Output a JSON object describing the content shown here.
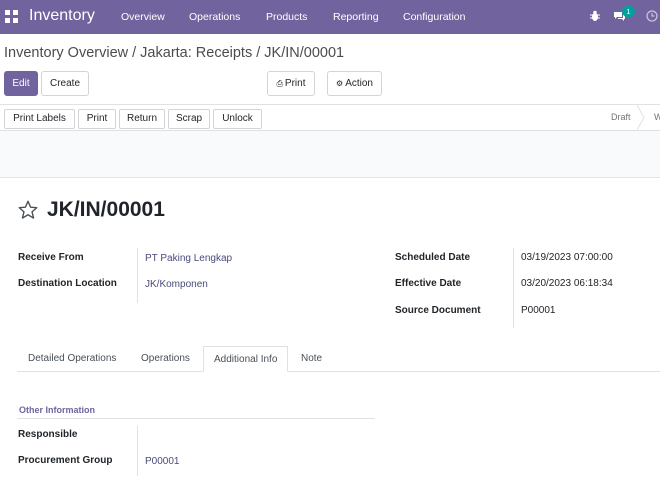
{
  "navbar": {
    "app_name": "Inventory",
    "menu": [
      "Overview",
      "Operations",
      "Products",
      "Reporting",
      "Configuration"
    ],
    "chat_badge": "1",
    "icons": [
      "apps-icon",
      "bug-icon",
      "chat-icon",
      "clock-icon"
    ],
    "color": "#71639e"
  },
  "breadcrumb": "Inventory Overview / Jakarta: Receipts / JK/IN/00001",
  "control": {
    "edit": "Edit",
    "create": "Create",
    "print": "Print",
    "action": "Action"
  },
  "statusbar": {
    "buttons": [
      "Print Labels",
      "Print",
      "Return",
      "Scrap",
      "Unlock"
    ],
    "stages": [
      "Draft",
      "W"
    ]
  },
  "record": {
    "title": "JK/IN/00001",
    "fields_left": [
      {
        "label": "Receive From",
        "value": "PT Paking Lengkap"
      },
      {
        "label": "Destination Location",
        "value": "JK/Komponen"
      }
    ],
    "fields_right": [
      {
        "label": "Scheduled Date",
        "value": "03/19/2023 07:00:00"
      },
      {
        "label": "Effective Date",
        "value": "03/20/2023 06:18:34"
      },
      {
        "label": "Source Document",
        "value": "P00001"
      }
    ]
  },
  "tabs": {
    "items": [
      "Detailed Operations",
      "Operations",
      "Additional Info",
      "Note"
    ],
    "active": "Additional Info"
  },
  "other_info": {
    "title": "Other Information",
    "fields": [
      {
        "label": "Responsible",
        "value": ""
      },
      {
        "label": "Procurement Group",
        "value": "P00001"
      }
    ]
  }
}
